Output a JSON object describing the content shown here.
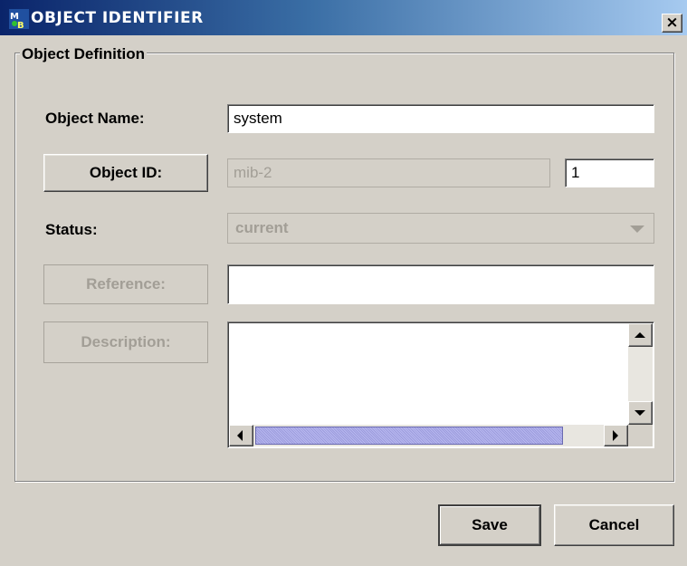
{
  "window": {
    "title": "OBJECT IDENTIFIER",
    "icon": "mib-browser-app-icon",
    "close_label": "×",
    "titlebar_colors": [
      "#0a246a",
      "#a6caf0"
    ]
  },
  "group": {
    "title": "Object Definition"
  },
  "form": {
    "object_name": {
      "label": "Object Name:",
      "value": "system"
    },
    "object_id": {
      "button_label": "Object ID:",
      "parent_value": "mib-2",
      "index_value": "1"
    },
    "status": {
      "label": "Status:",
      "selected": "current"
    },
    "reference": {
      "button_label": "Reference:",
      "value": ""
    },
    "description": {
      "button_label": "Description:",
      "value": ""
    }
  },
  "footer": {
    "save_label": "Save",
    "cancel_label": "Cancel"
  }
}
